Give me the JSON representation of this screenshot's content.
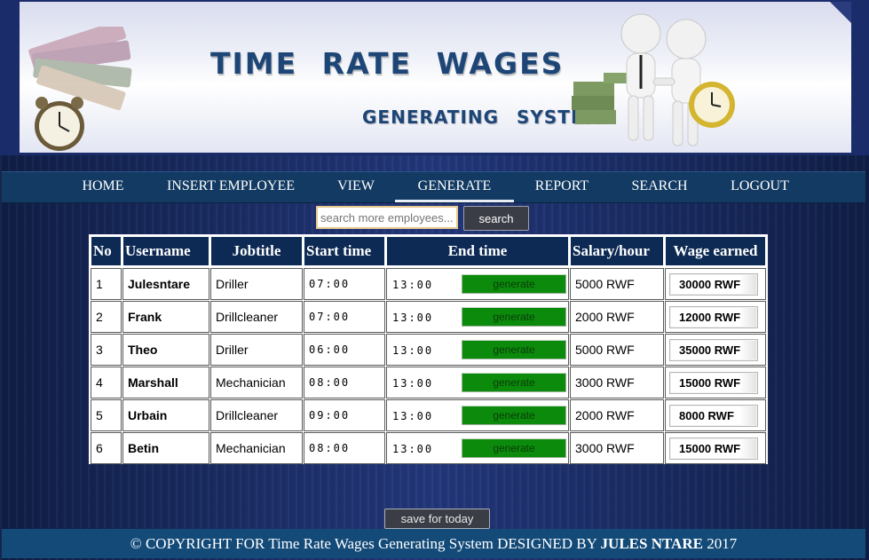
{
  "banner": {
    "title": "TIME  RATE  WAGES",
    "subtitle": "GENERATING  SYSTEM"
  },
  "nav": {
    "items": [
      {
        "label": "HOME"
      },
      {
        "label": "INSERT EMPLOYEE"
      },
      {
        "label": "VIEW"
      },
      {
        "label": "GENERATE",
        "active": true
      },
      {
        "label": "REPORT"
      },
      {
        "label": "SEARCH"
      },
      {
        "label": "LOGOUT"
      }
    ]
  },
  "search": {
    "placeholder": "search more employees...",
    "button_label": "search"
  },
  "table": {
    "headers": [
      "No",
      "Username",
      "Jobtitle",
      "Start time",
      "End time",
      "Salary/hour",
      "Wage earned"
    ],
    "generate_label": "generate",
    "rows": [
      {
        "no": "1",
        "username": "Julesntare",
        "jobtitle": "Driller",
        "start": "07:00",
        "end": "13:00",
        "salary": "5000 RWF",
        "wage": "30000 RWF"
      },
      {
        "no": "2",
        "username": "Frank",
        "jobtitle": "Drillcleaner",
        "start": "07:00",
        "end": "13:00",
        "salary": "2000 RWF",
        "wage": "12000 RWF"
      },
      {
        "no": "3",
        "username": "Theo",
        "jobtitle": "Driller",
        "start": "06:00",
        "end": "13:00",
        "salary": "5000 RWF",
        "wage": "35000 RWF"
      },
      {
        "no": "4",
        "username": "Marshall",
        "jobtitle": "Mechanician",
        "start": "08:00",
        "end": "13:00",
        "salary": "3000 RWF",
        "wage": "15000 RWF"
      },
      {
        "no": "5",
        "username": "Urbain",
        "jobtitle": "Drillcleaner",
        "start": "09:00",
        "end": "13:00",
        "salary": "2000 RWF",
        "wage": "8000 RWF"
      },
      {
        "no": "6",
        "username": "Betin",
        "jobtitle": "Mechanician",
        "start": "08:00",
        "end": "13:00",
        "salary": "3000 RWF",
        "wage": "15000 RWF"
      }
    ]
  },
  "save_button": "save for today",
  "footer": {
    "prefix": "© COPYRIGHT FOR",
    "system": "Time Rate Wages Generating System",
    "designed": "DESIGNED BY",
    "author": "JULES NTARE",
    "year": "2017"
  },
  "colors": {
    "nav_bg": "#123a62",
    "header_bg": "#0d2a54",
    "generate_green": "#0b8a0b",
    "title_blue": "#1d4677"
  }
}
